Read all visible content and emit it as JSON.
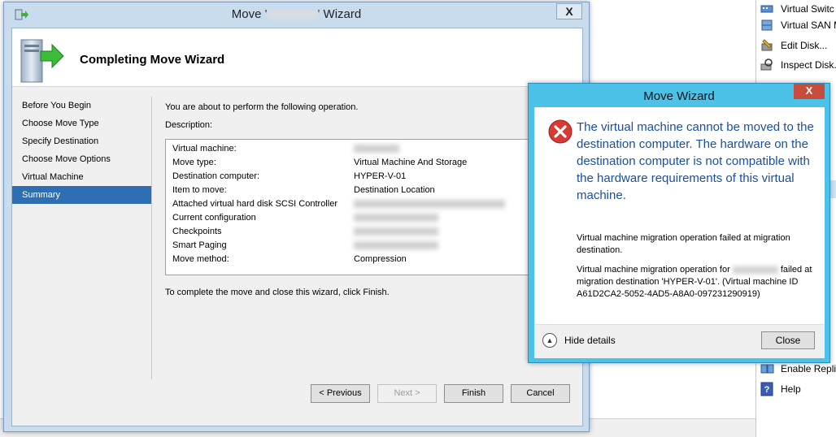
{
  "background_app": {
    "actions": [
      {
        "label": "Virtual Switc",
        "icon": "switch-icon"
      },
      {
        "label": "Virtual SAN M",
        "icon": "san-icon"
      },
      {
        "label": "Edit Disk...",
        "icon": "edit-disk-icon"
      },
      {
        "label": "Inspect Disk...",
        "icon": "inspect-disk-icon"
      },
      {
        "label": "Enable Replic",
        "icon": "replication-icon"
      },
      {
        "label": "Help",
        "icon": "help-icon"
      }
    ]
  },
  "wizard": {
    "title_prefix": "Move '",
    "title_suffix": "' Wizard",
    "close_label": "X",
    "header_title": "Completing Move Wizard",
    "nav": [
      {
        "label": "Before You Begin",
        "selected": false
      },
      {
        "label": "Choose Move Type",
        "selected": false
      },
      {
        "label": "Specify Destination",
        "selected": false
      },
      {
        "label": "Choose Move Options",
        "selected": false
      },
      {
        "label": "Virtual Machine",
        "selected": false
      },
      {
        "label": "Summary",
        "selected": true
      }
    ],
    "intro": "You are about to perform the following operation.",
    "description_label": "Description:",
    "description_rows": [
      {
        "key": "Virtual machine:",
        "value": ""
      },
      {
        "key": "Move type:",
        "value": "Virtual Machine And Storage"
      },
      {
        "key": "Destination computer:",
        "value": "HYPER-V-01"
      },
      {
        "key": "Item to move:",
        "value": "Destination Location"
      },
      {
        "key": "Attached virtual hard disk  SCSI Controller",
        "value": ""
      },
      {
        "key": "Current configuration",
        "value": ""
      },
      {
        "key": "Checkpoints",
        "value": ""
      },
      {
        "key": "Smart Paging",
        "value": ""
      },
      {
        "key": "Move method:",
        "value": "Compression"
      }
    ],
    "finish_note": "To complete the move and close this wizard, click Finish.",
    "buttons": {
      "previous": "< Previous",
      "next": "Next >",
      "finish": "Finish",
      "cancel": "Cancel"
    }
  },
  "error_dialog": {
    "title": "Move Wizard",
    "close_label": "X",
    "main_message": "The virtual machine cannot be moved to the destination computer. The hardware on the destination computer is not compatible with the hardware requirements of this virtual machine.",
    "detail_1": "Virtual machine migration operation failed at migration destination.",
    "detail_2_prefix": "Virtual machine migration operation for",
    "detail_2_suffix": "failed at migration destination 'HYPER-V-01'. (Virtual machine ID A61D2CA2-5052-4AD5-A8A0-097231290919)",
    "toggle_label": "Hide details",
    "close_button": "Close"
  }
}
